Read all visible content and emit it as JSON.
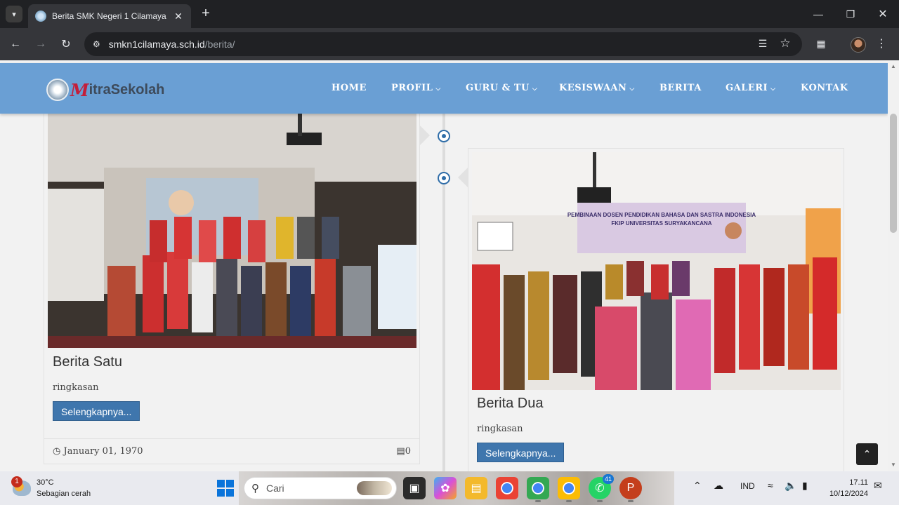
{
  "browser": {
    "tab_title": "Berita SMK Negeri 1 Cilamaya",
    "url_host": "smkn1cilamaya.sch.id",
    "url_path": "/berita/"
  },
  "site": {
    "logo_m": "M",
    "logo_rest_a": "itra",
    "logo_rest_b": " Sekolah",
    "menu": [
      {
        "label": "HOME",
        "dropdown": false
      },
      {
        "label": "PROFIL",
        "dropdown": true
      },
      {
        "label": "GURU & TU",
        "dropdown": true
      },
      {
        "label": "KESISWAAN",
        "dropdown": true
      },
      {
        "label": "BERITA",
        "dropdown": false
      },
      {
        "label": "GALERI",
        "dropdown": true
      },
      {
        "label": "KONTAK",
        "dropdown": false
      }
    ]
  },
  "posts": [
    {
      "title": "Berita Satu",
      "summary": "ringkasan",
      "button": "Selengkapnya...",
      "date": "January 01, 1970",
      "views": "0"
    },
    {
      "title": "Berita Dua",
      "summary": "ringkasan",
      "button": "Selengkapnya..."
    }
  ],
  "photo_banner": {
    "line1": "PEMBINAAN DOSEN PENDIDIKAN BAHASA DAN SASTRA INDONESIA",
    "line2": "FKIP UNIVERSITAS SURYAKANCANA"
  },
  "taskbar": {
    "weather_temp": "30°C",
    "weather_desc": "Sebagian cerah",
    "weather_badge": "1",
    "search_placeholder": "Cari",
    "whatsapp_count": "41",
    "lang": "IND",
    "time": "17.11",
    "date": "10/12/2024"
  },
  "colors": {
    "navbar": "#6a9fd4",
    "button": "#3f76ad",
    "timeline_dot": "#2f6da8"
  }
}
